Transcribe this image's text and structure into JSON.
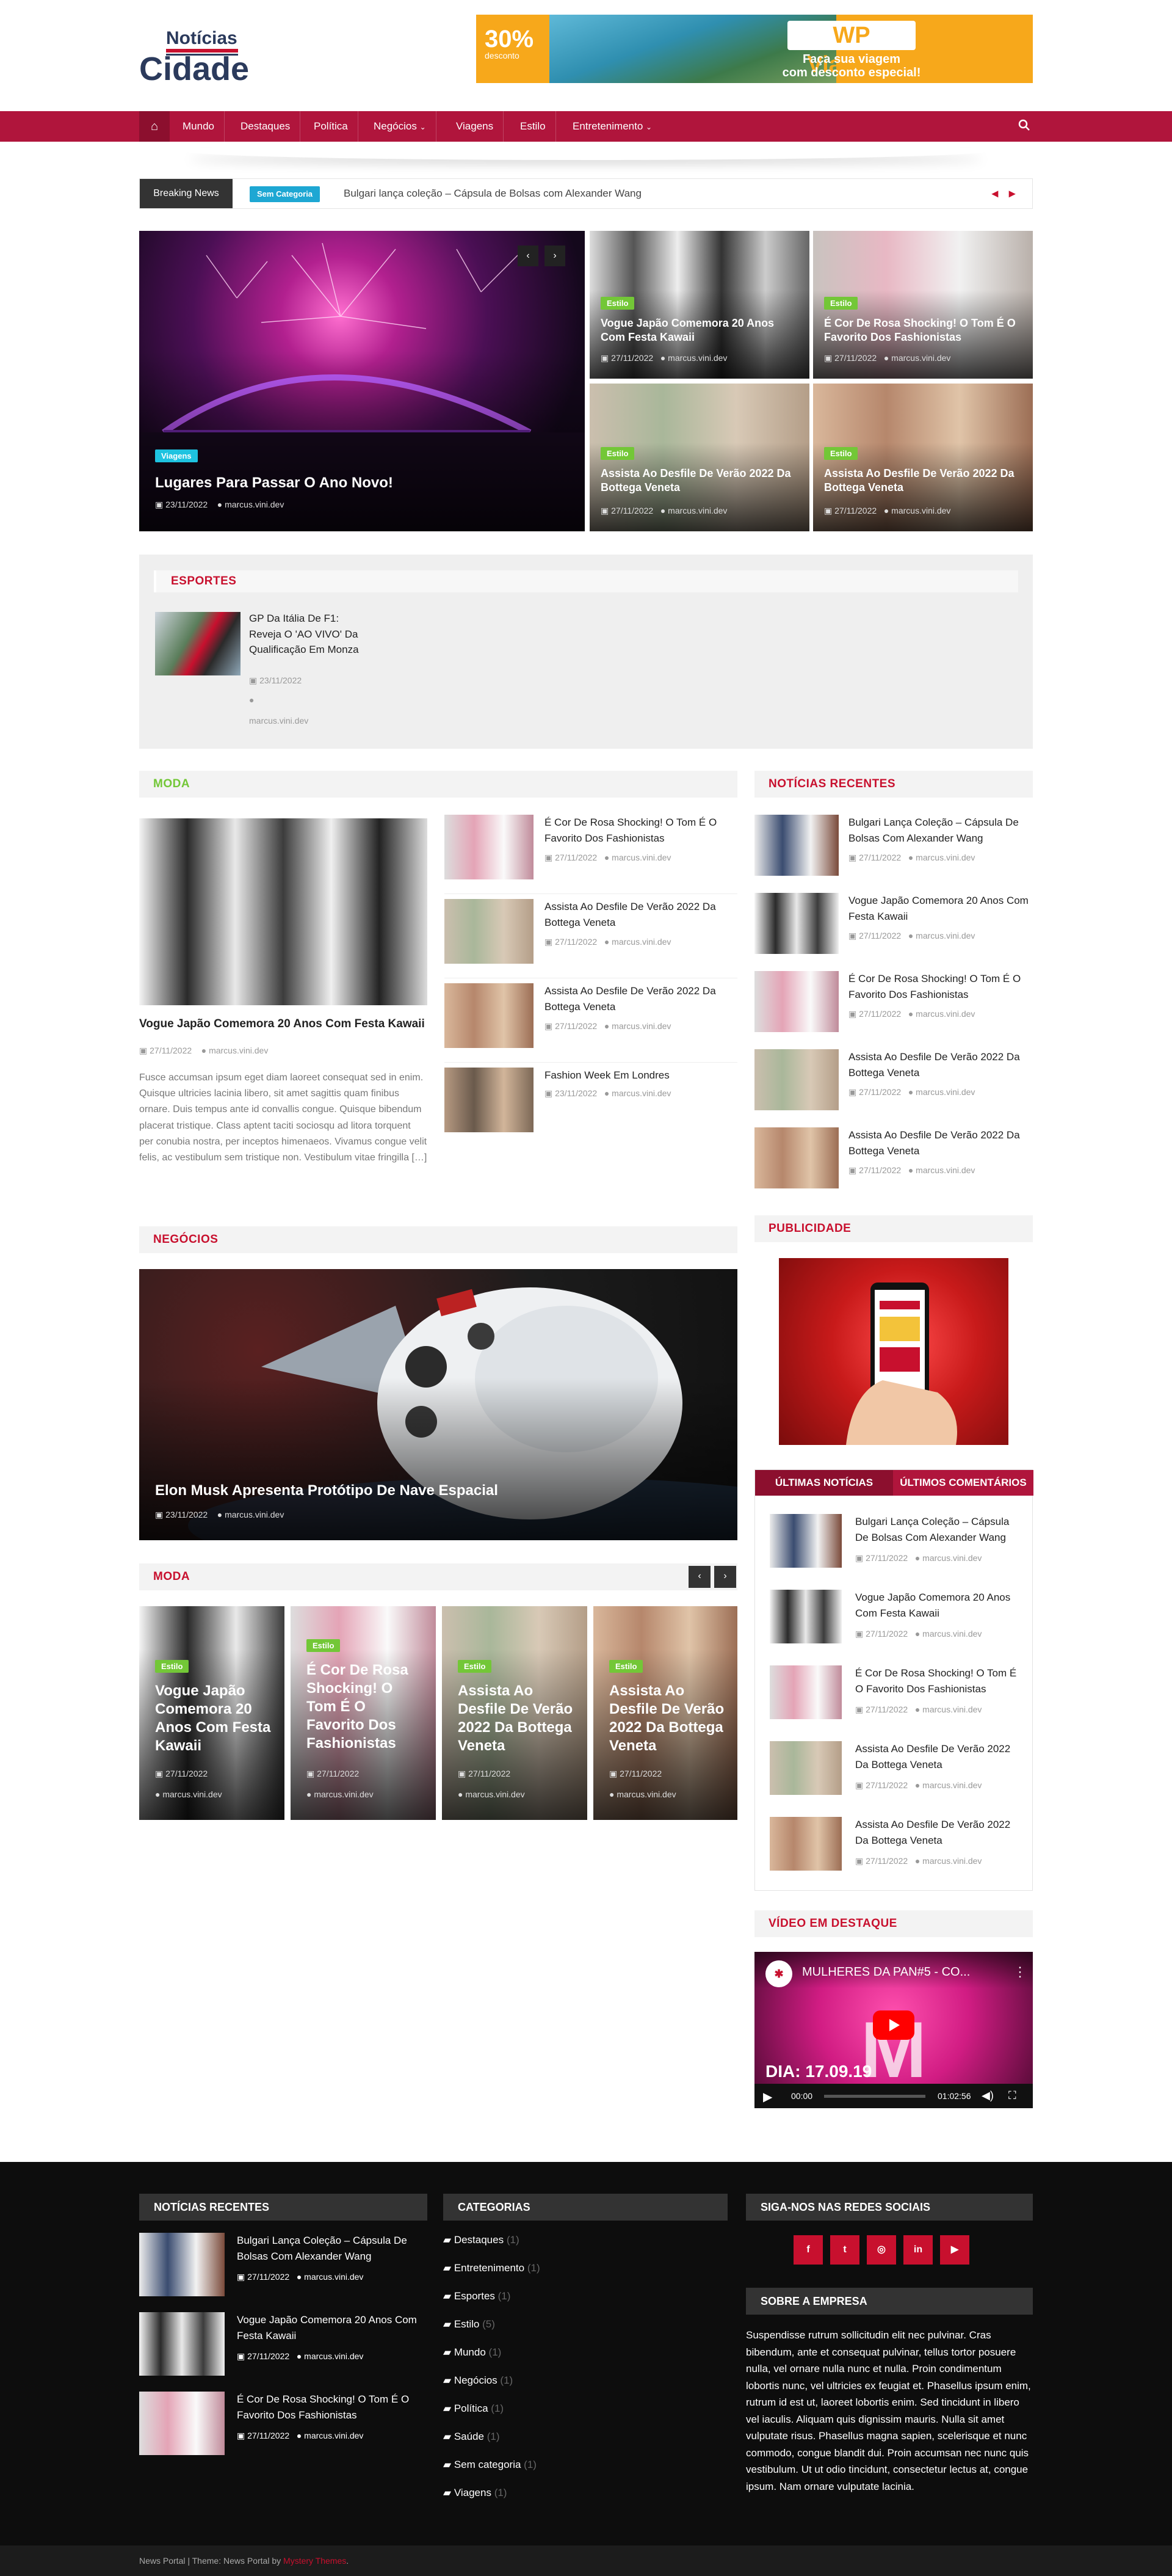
{
  "header": {
    "logo_top": "Notícias",
    "logo_main": "Cidade",
    "banner": {
      "percent": "30%",
      "percent_sub": "desconto",
      "brand": "WP Viagens",
      "sub1": "Faça sua viagem",
      "sub2": "com desconto especial!"
    }
  },
  "nav": {
    "home_icon": "home-icon",
    "items": [
      "Mundo",
      "Destaques",
      "Política",
      "Negócios",
      "Viagens",
      "Estilo",
      "Entretenimento"
    ],
    "search_icon": "search-icon"
  },
  "breaking": {
    "label": "Breaking News",
    "category": "Sem Categoria",
    "text": "Bulgari lança coleção – Cápsula de Bolsas com Alexander Wang"
  },
  "hero": {
    "main": {
      "badge": "Viagens",
      "title": "Lugares Para Passar O Ano Novo!",
      "date": "23/11/2022",
      "author": "marcus.vini.dev"
    },
    "t1": {
      "badge": "Estilo",
      "title": "Vogue Japão Comemora 20 Anos Com Festa Kawaii",
      "date": "27/11/2022",
      "author": "marcus.vini.dev"
    },
    "t2": {
      "badge": "Estilo",
      "title": "É Cor De Rosa Shocking! O Tom É O Favorito Dos Fashionistas",
      "date": "27/11/2022",
      "author": "marcus.vini.dev"
    },
    "t3": {
      "badge": "Estilo",
      "title": "Assista Ao Desfile De Verão 2022 Da Bottega Veneta",
      "date": "27/11/2022",
      "author": "marcus.vini.dev"
    },
    "t4": {
      "badge": "Estilo",
      "title": "Assista Ao Desfile De Verão 2022 Da Bottega Veneta",
      "date": "27/11/2022",
      "author": "marcus.vini.dev"
    }
  },
  "esportes": {
    "title": "ESPORTES",
    "post_title": "GP Da Itália De F1: Reveja O 'AO VIVO' Da Qualificação Em Monza",
    "date": "23/11/2022",
    "author": "marcus.vini.dev"
  },
  "moda": {
    "title": "MODA",
    "main_title": "Vogue Japão Comemora 20 Anos Com Festa Kawaii",
    "main_date": "27/11/2022",
    "main_author": "marcus.vini.dev",
    "excerpt": "Fusce accumsan ipsum eget diam laoreet consequat sed in enim. Quisque ultricies lacinia libero, sit amet sagittis quam finibus ornare. Duis tempus ante id convallis congue. Quisque bibendum placerat tristique. Class aptent taciti sociosqu ad litora torquent per conubia nostra, per inceptos himenaeos. Vivamus congue velit felis, ac vestibulum sem tristique non. Vestibulum vitae fringilla […]",
    "list": [
      {
        "title": "É Cor De Rosa Shocking! O Tom É O Favorito Dos Fashionistas",
        "date": "27/11/2022",
        "author": "marcus.vini.dev"
      },
      {
        "title": "Assista Ao Desfile De Verão 2022 Da Bottega Veneta",
        "date": "27/11/2022",
        "author": "marcus.vini.dev"
      },
      {
        "title": "Assista Ao Desfile De Verão 2022 Da Bottega Veneta",
        "date": "27/11/2022",
        "author": "marcus.vini.dev"
      },
      {
        "title": "Fashion Week Em Londres",
        "date": "23/11/2022",
        "author": "marcus.vini.dev"
      }
    ]
  },
  "recentes": {
    "title": "NOTÍCIAS RECENTES",
    "list": [
      {
        "title": "Bulgari Lança Coleção – Cápsula De Bolsas Com Alexander Wang",
        "date": "27/11/2022",
        "author": "marcus.vini.dev"
      },
      {
        "title": "Vogue Japão Comemora 20 Anos Com Festa Kawaii",
        "date": "27/11/2022",
        "author": "marcus.vini.dev"
      },
      {
        "title": "É Cor De Rosa Shocking! O Tom É O Favorito Dos Fashionistas",
        "date": "27/11/2022",
        "author": "marcus.vini.dev"
      },
      {
        "title": "Assista Ao Desfile De Verão 2022 Da Bottega Veneta",
        "date": "27/11/2022",
        "author": "marcus.vini.dev"
      },
      {
        "title": "Assista Ao Desfile De Verão 2022 Da Bottega Veneta",
        "date": "27/11/2022",
        "author": "marcus.vini.dev"
      }
    ]
  },
  "negocios": {
    "title": "NEGÓCIOS",
    "post_title": "Elon Musk Apresenta Protótipo De Nave Espacial",
    "date": "23/11/2022",
    "author": "marcus.vini.dev"
  },
  "publicidade": {
    "title": "PUBLICIDADE"
  },
  "tabs": {
    "tab1": "ÚLTIMAS NOTÍCIAS",
    "tab2": "ÚLTIMOS COMENTÁRIOS",
    "list": [
      {
        "title": "Bulgari Lança Coleção – Cápsula De Bolsas Com Alexander Wang",
        "date": "27/11/2022",
        "author": "marcus.vini.dev"
      },
      {
        "title": "Vogue Japão Comemora 20 Anos Com Festa Kawaii",
        "date": "27/11/2022",
        "author": "marcus.vini.dev"
      },
      {
        "title": "É Cor De Rosa Shocking! O Tom É O Favorito Dos Fashionistas",
        "date": "27/11/2022",
        "author": "marcus.vini.dev"
      },
      {
        "title": "Assista Ao Desfile De Verão 2022 Da Bottega Veneta",
        "date": "27/11/2022",
        "author": "marcus.vini.dev"
      },
      {
        "title": "Assista Ao Desfile De Verão 2022 Da Bottega Veneta",
        "date": "27/11/2022",
        "author": "marcus.vini.dev"
      }
    ]
  },
  "moda2": {
    "title": "MODA",
    "cards": [
      {
        "badge": "Estilo",
        "title": "Vogue Japão Comemora 20 Anos Com Festa Kawaii",
        "date": "27/11/2022",
        "author": "marcus.vini.dev"
      },
      {
        "badge": "Estilo",
        "title": "É Cor De Rosa Shocking! O Tom É O Favorito Dos Fashionistas",
        "date": "27/11/2022",
        "author": "marcus.vini.dev"
      },
      {
        "badge": "Estilo",
        "title": "Assista Ao Desfile De Verão 2022 Da Bottega Veneta",
        "date": "27/11/2022",
        "author": "marcus.vini.dev"
      },
      {
        "badge": "Estilo",
        "title": "Assista Ao Desfile De Verão 2022 Da Bottega Veneta",
        "date": "27/11/2022",
        "author": "marcus.vini.dev"
      }
    ]
  },
  "video": {
    "title": "VÍDEO EM DESTAQUE",
    "video_title": "MULHERES DA PAN#5 - CO...",
    "overlay_text": "DIA: 17.09.19",
    "time_current": "00:00",
    "time_total": "01:02:56"
  },
  "footer": {
    "recentes_title": "NOTÍCIAS RECENTES",
    "recentes": [
      {
        "title": "Bulgari Lança Coleção – Cápsula De Bolsas Com Alexander Wang",
        "date": "27/11/2022",
        "author": "marcus.vini.dev"
      },
      {
        "title": "Vogue Japão Comemora 20 Anos Com Festa Kawaii",
        "date": "27/11/2022",
        "author": "marcus.vini.dev"
      },
      {
        "title": "É Cor De Rosa Shocking! O Tom É O Favorito Dos Fashionistas",
        "date": "27/11/2022",
        "author": "marcus.vini.dev"
      }
    ],
    "categorias_title": "CATEGORIAS",
    "categorias": [
      {
        "name": "Destaques",
        "count": "(1)"
      },
      {
        "name": "Entretenimento",
        "count": "(1)"
      },
      {
        "name": "Esportes",
        "count": "(1)"
      },
      {
        "name": "Estilo",
        "count": "(5)"
      },
      {
        "name": "Mundo",
        "count": "(1)"
      },
      {
        "name": "Negócios",
        "count": "(1)"
      },
      {
        "name": "Política",
        "count": "(1)"
      },
      {
        "name": "Saúde",
        "count": "(1)"
      },
      {
        "name": "Sem categoria",
        "count": "(1)"
      },
      {
        "name": "Viagens",
        "count": "(1)"
      }
    ],
    "social_title": "SIGA-NOS NAS REDES SOCIAIS",
    "social": [
      "f",
      "t",
      "◎",
      "in",
      "▶"
    ],
    "sobre_title": "SOBRE A EMPRESA",
    "sobre_text": "Suspendisse rutrum sollicitudin elit nec pulvinar. Cras bibendum, ante et consequat pulvinar, tellus tortor posuere nulla, vel ornare nulla nunc et nulla. Proin condimentum lobortis nunc, vel ultricies ex feugiat et. Phasellus ipsum enim, rutrum id est ut, laoreet lobortis enim. Sed tincidunt in libero vel iaculis. Aliquam quis dignissim mauris. Nulla sit amet vulputate risus. Phasellus magna sapien, scelerisque et nunc commodo, congue blandit dui. Proin accumsan nec nunc quis vestibulum. Ut ut odio tincidunt, consectetur lectus at, congue ipsum. Nam ornare vulputate lacinia.",
    "credit_prefix": "News Portal | Theme: News Portal by ",
    "credit_link": "Mystery Themes",
    "credit_suffix": "."
  }
}
